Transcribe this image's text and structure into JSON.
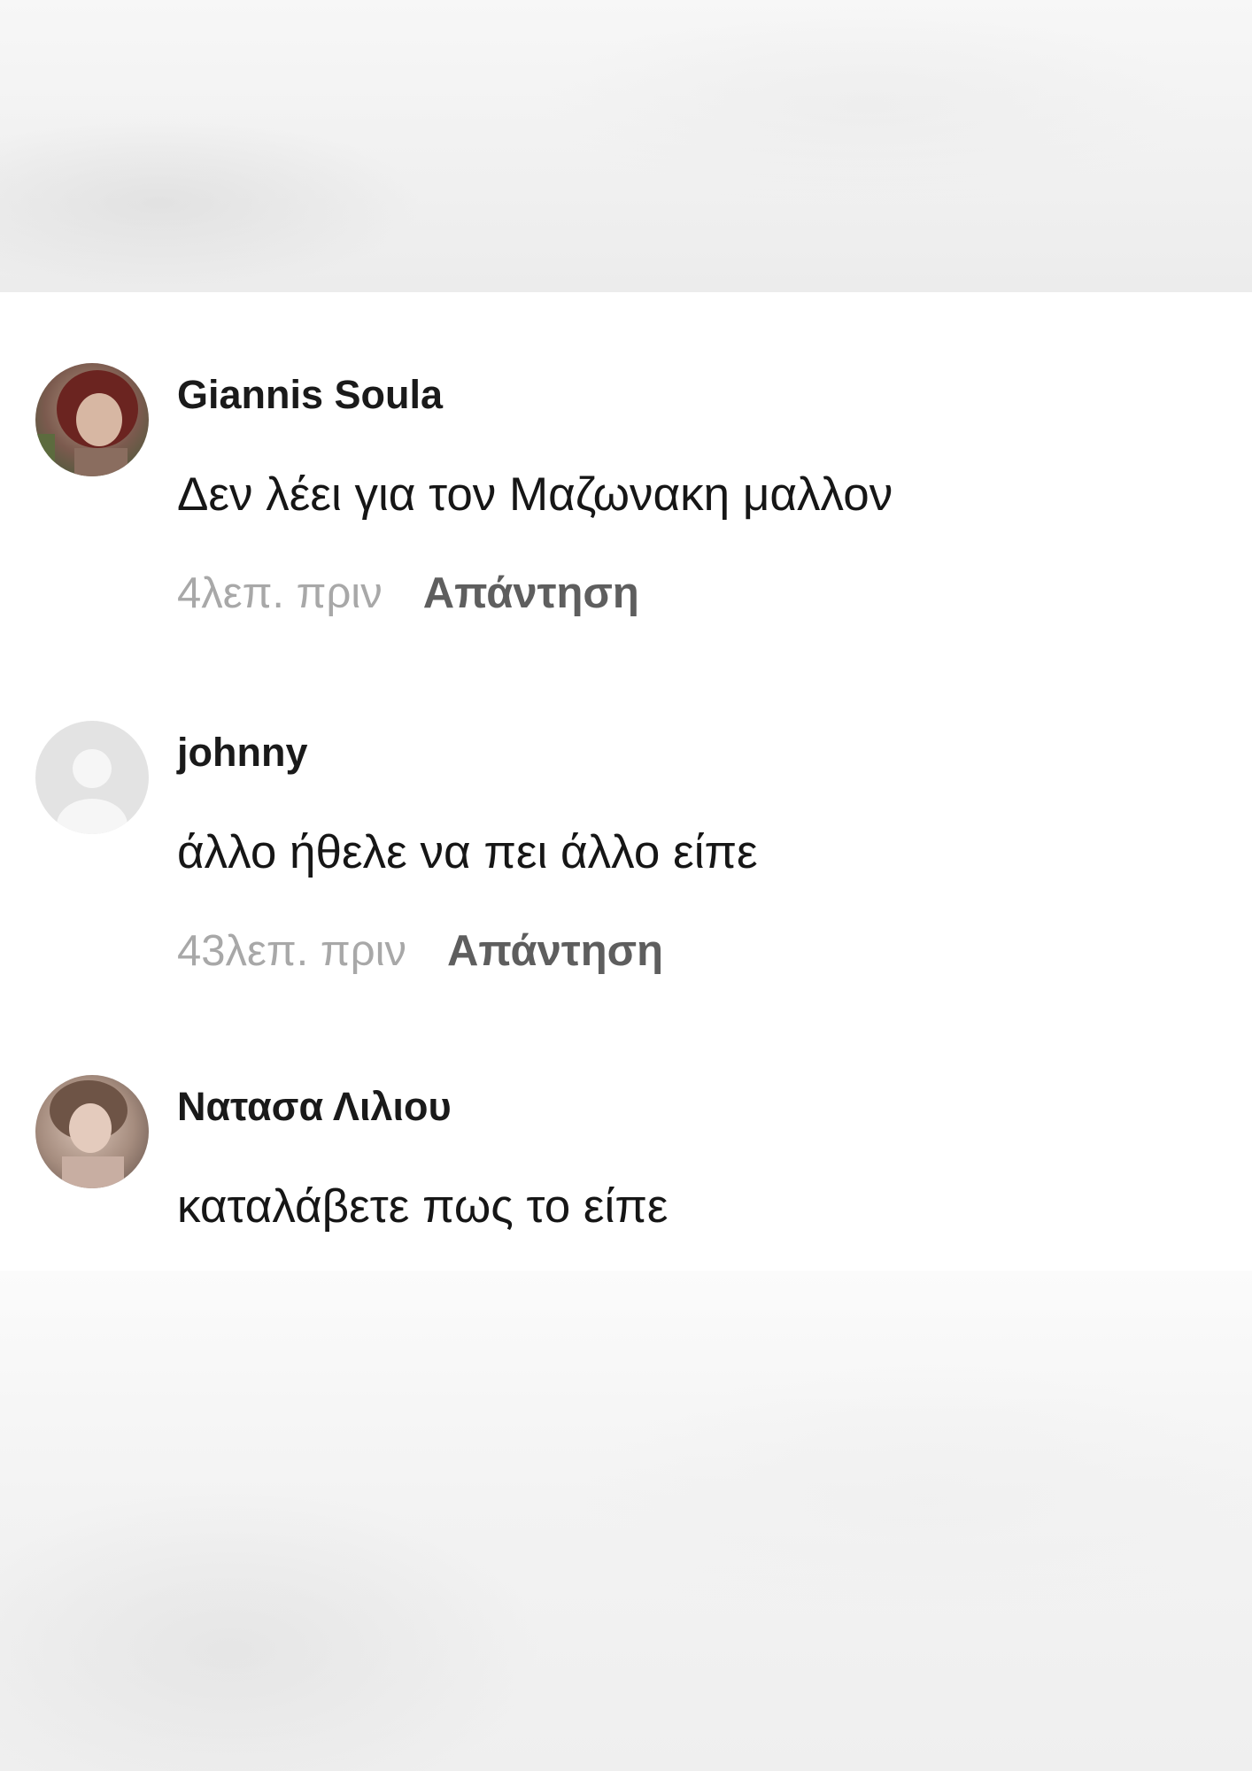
{
  "comments": [
    {
      "author": "Giannis Soula",
      "avatar_icon": "user-photo-avatar",
      "text": "Δεν λέει για τον Μαζωνακη μαλλον",
      "time": "4λεπ. πριν",
      "reply_label": "Απάντηση"
    },
    {
      "author": "johnny",
      "avatar_icon": "default-user-avatar-icon",
      "text": "άλλο ήθελε να πει άλλο είπε",
      "time": "43λεπ. πριν",
      "reply_label": "Απάντηση"
    },
    {
      "author": "Νατασα Λιλιου",
      "avatar_icon": "user-photo-avatar",
      "text": "καταλάβετε πως το είπε"
    }
  ],
  "colors": {
    "author": "#1a1a1a",
    "text": "#161616",
    "time": "#a8a8a8",
    "reply": "#5e5e5e"
  }
}
